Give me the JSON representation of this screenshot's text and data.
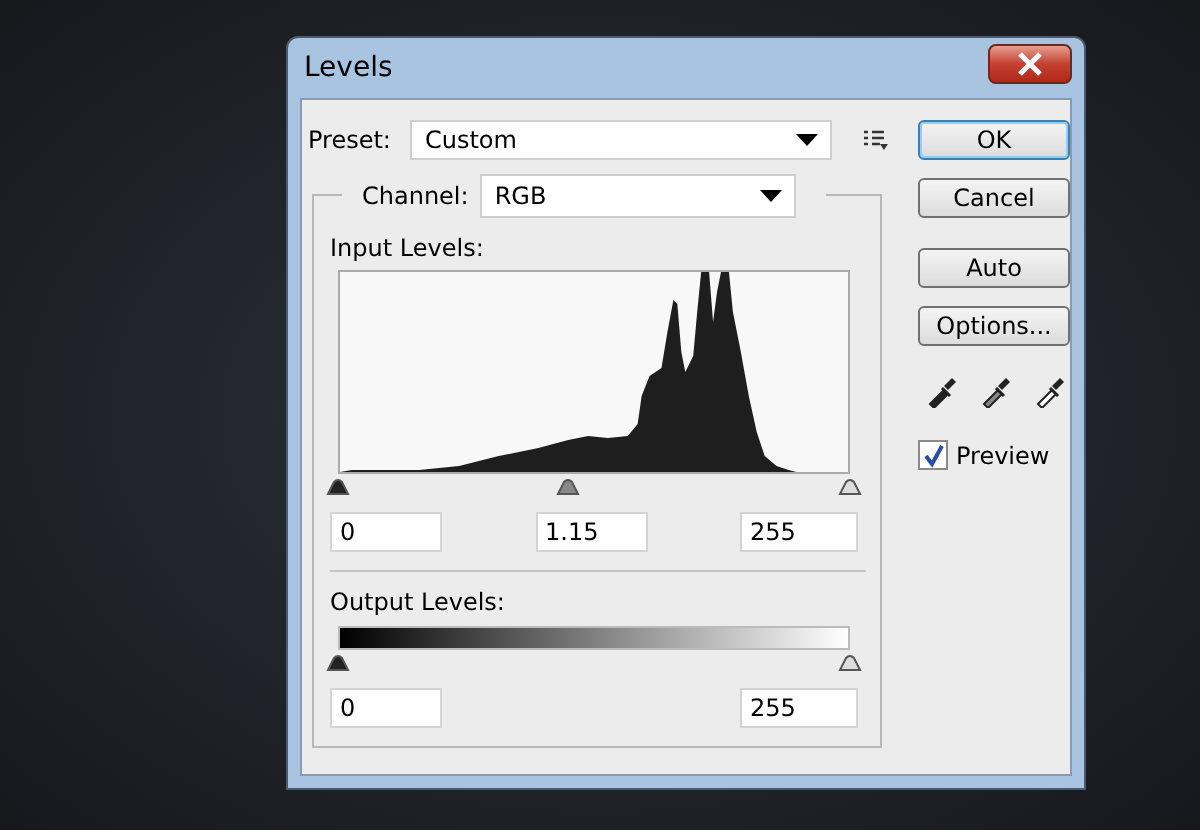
{
  "window": {
    "title": "Levels"
  },
  "preset": {
    "label": "Preset:",
    "value": "Custom"
  },
  "channel": {
    "label": "Channel:",
    "value": "RGB"
  },
  "input_levels": {
    "label": "Input Levels:",
    "handles": [
      {
        "kind": "black",
        "level": 0
      },
      {
        "kind": "gray",
        "level": 0.45
      },
      {
        "kind": "white",
        "level": 1
      }
    ],
    "fields": [
      "0",
      "1.15",
      "255"
    ]
  },
  "output_levels": {
    "label": "Output Levels:",
    "handles": [
      {
        "kind": "black",
        "level": 0
      },
      {
        "kind": "white",
        "level": 1
      }
    ],
    "fields": [
      "0",
      "255"
    ]
  },
  "buttons": [
    {
      "label": "OK",
      "default": true
    },
    {
      "label": "Cancel",
      "default": false
    },
    {
      "label": "Auto",
      "default": false
    },
    {
      "label": "Options...",
      "default": false
    }
  ],
  "eyedroppers": [
    {
      "kind": "black"
    },
    {
      "kind": "gray"
    },
    {
      "kind": "white"
    }
  ],
  "preview": {
    "label": "Preview",
    "checked": true
  }
}
